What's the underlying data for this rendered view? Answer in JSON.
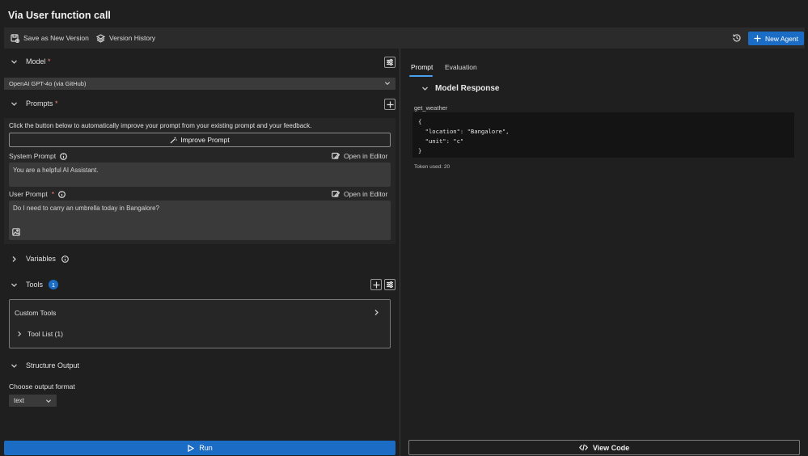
{
  "title": "Via User function call",
  "toolbar": {
    "save_label": "Save as New Version",
    "history_label": "Version History",
    "new_agent_label": "New Agent"
  },
  "model": {
    "label": "Model",
    "required_mark": "*",
    "selected": "OpenAI GPT-4o (via GitHub)"
  },
  "prompts": {
    "label": "Prompts",
    "required_mark": "*",
    "hint": "Click the button below to automatically improve your prompt from your existing prompt and your feedback.",
    "improve_label": "Improve Prompt",
    "system_label": "System Prompt",
    "system_value": "You are a helpful AI Assistant.",
    "user_label": "User Prompt",
    "user_required_mark": "*",
    "user_value": "Do I need to carry an umbrella today in Bangalore?",
    "open_editor_label": "Open in Editor"
  },
  "variables": {
    "label": "Variables"
  },
  "tools": {
    "label": "Tools",
    "count": "1",
    "custom_tools_label": "Custom Tools",
    "tool_list_label": "Tool List (1)"
  },
  "structure_output": {
    "label": "Structure Output",
    "choose_label": "Choose output format",
    "selected": "text"
  },
  "run_label": "Run",
  "tabs": [
    {
      "label": "Prompt",
      "active": true
    },
    {
      "label": "Evaluation",
      "active": false
    }
  ],
  "response": {
    "heading": "Model Response",
    "function_name": "get_weather",
    "code": "{\n  \"location\": \"Bangalore\",\n  \"unit\": \"c\"\n}",
    "tokens": "Token used: 20"
  },
  "view_code_label": "View Code",
  "colors": {
    "background": "#1f1f1f",
    "accent": "#1b6cc4",
    "tab_underline": "#4aa0f0",
    "required": "#f0807f"
  }
}
